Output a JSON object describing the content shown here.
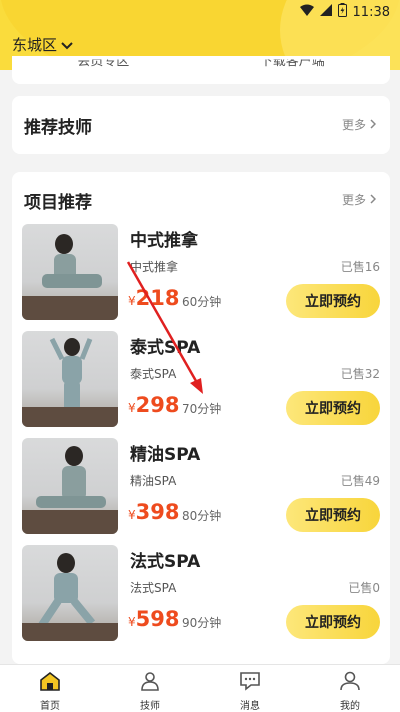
{
  "status_bar": {
    "time": "11:38"
  },
  "header": {
    "district": "东城区"
  },
  "top_card": {
    "partial_left": "会员专区",
    "partial_right": "下载客户端"
  },
  "recommend_tech": {
    "title": "推荐技师",
    "more": "更多"
  },
  "projects": {
    "title": "项目推荐",
    "more": "更多",
    "items": [
      {
        "title": "中式推拿",
        "sub": "中式推拿",
        "sold": "已售16",
        "yen": "¥",
        "price": "218",
        "duration": "60分钟",
        "button": "立即预约"
      },
      {
        "title": "泰式SPA",
        "sub": "泰式SPA",
        "sold": "已售32",
        "yen": "¥",
        "price": "298",
        "duration": "70分钟",
        "button": "立即预约"
      },
      {
        "title": "精油SPA",
        "sub": "精油SPA",
        "sold": "已售49",
        "yen": "¥",
        "price": "398",
        "duration": "80分钟",
        "button": "立即预约"
      },
      {
        "title": "法式SPA",
        "sub": "法式SPA",
        "sold": "已售0",
        "yen": "¥",
        "price": "598",
        "duration": "90分钟",
        "button": "立即预约"
      }
    ]
  },
  "tabbar": {
    "tabs": [
      {
        "label": "首页",
        "icon": "home-icon"
      },
      {
        "label": "技师",
        "icon": "technician-icon"
      },
      {
        "label": "消息",
        "icon": "message-icon"
      },
      {
        "label": "我的",
        "icon": "profile-icon"
      }
    ]
  },
  "colors": {
    "accent": "#fadc3c",
    "price": "#ee4b1e",
    "annotation_arrow": "#e02020"
  }
}
